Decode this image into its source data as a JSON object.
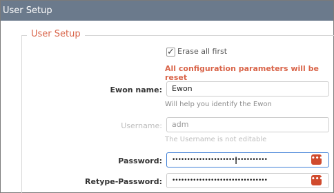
{
  "title": "User Setup",
  "legend": "User Setup",
  "erase_checkbox": {
    "label": "Erase all first",
    "checked": true
  },
  "warning": "All configuration parameters will be reset",
  "ewon_name": {
    "label": "Ewon name:",
    "value": "Ewon",
    "hint": "Will help you identify the Ewon"
  },
  "username": {
    "label": "Username:",
    "value": "adm",
    "hint": "The Username is not editable"
  },
  "password": {
    "label": "Password:",
    "value": "••••••••••••••••••••••••••••••••",
    "reveal_icon": "dots-icon"
  },
  "retype_password": {
    "label": "Retype-Password:",
    "value": "••••••••••••••••••••••••••••••••",
    "reveal_icon": "dots-icon"
  },
  "colors": {
    "title_bar": "#6b7a8c",
    "accent": "#d9654a",
    "button": "#d04a2d",
    "focus": "#3f7fd6"
  }
}
